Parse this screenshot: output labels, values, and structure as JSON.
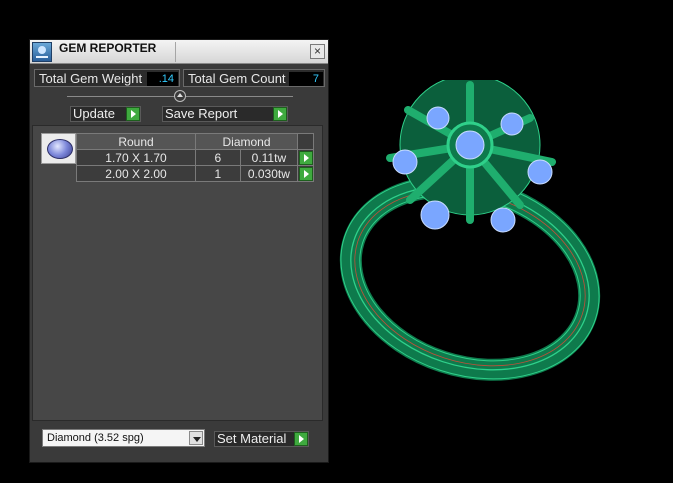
{
  "window": {
    "title": "GEM REPORTER",
    "close_icon": "close-icon"
  },
  "stats": {
    "weight_label": "Total Gem Weight",
    "weight_value": ".14",
    "count_label": "Total Gem Count",
    "count_value": "7"
  },
  "buttons": {
    "update": "Update",
    "save_report": "Save Report",
    "set_material": "Set Material"
  },
  "table": {
    "headers": [
      "Round",
      "Diamond"
    ],
    "rows": [
      {
        "size": "1.70 X 1.70",
        "count": "6",
        "weight": "0.11tw"
      },
      {
        "size": "2.00 X 2.00",
        "count": "1",
        "weight": "0.030tw"
      }
    ]
  },
  "material_select": {
    "value": "Diamond      (3.52 spg)"
  },
  "colors": {
    "value_text": "#33ccff",
    "go_button": "#3faa3f",
    "ring_metal": "#0e7a4c",
    "ring_highlight": "#2fd08a",
    "gem": "#7aa6ff"
  }
}
